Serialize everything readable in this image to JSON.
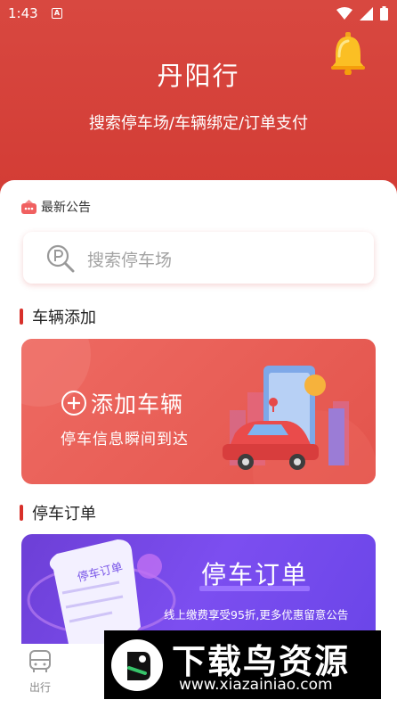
{
  "status_bar": {
    "time": "1:43",
    "a_badge": "A",
    "icons": [
      "wifi-icon",
      "signal-icon",
      "battery-icon"
    ]
  },
  "header": {
    "title": "丹阳行",
    "subtitle": "搜索停车场/车辆绑定/订单支付",
    "bell_icon": "bell-icon"
  },
  "notice": {
    "label": "最新公告"
  },
  "search": {
    "placeholder": "搜索停车场"
  },
  "sections": {
    "vehicle_add": {
      "title": "车辆添加",
      "banner_title": "添加车辆",
      "banner_subtitle": "停车信息瞬间到达"
    },
    "parking_order": {
      "title": "停车订单",
      "banner_title": "停车订单",
      "banner_subtitle": "线上缴费享受95折,更多优惠留意公告",
      "receipt_label": "停车订单"
    }
  },
  "tabbar": {
    "items": [
      {
        "label": "出行",
        "icon": "bus-icon"
      }
    ]
  },
  "watermark": {
    "title": "下载鸟资源",
    "url": "www.xiazainiao.com"
  },
  "colors": {
    "brand_red": "#d8433c",
    "section_bar": "#d8302a",
    "order_purple": "#7248e6"
  }
}
